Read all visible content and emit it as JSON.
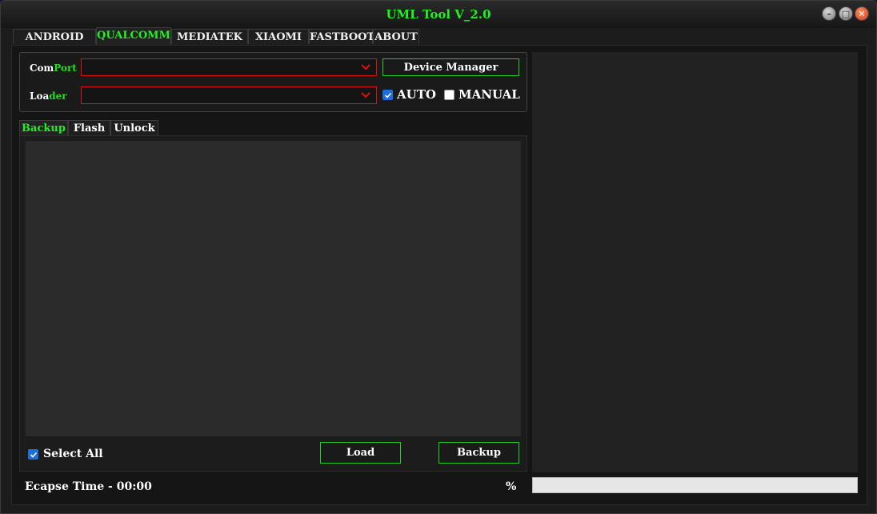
{
  "window": {
    "title": "UML Tool V_2.0",
    "controls": [
      "minimize",
      "maximize",
      "close"
    ]
  },
  "main_tabs": [
    {
      "label": "ANDROID",
      "active": false
    },
    {
      "label": "QUALCOMM",
      "active": true
    },
    {
      "label": "MEDIATEK",
      "active": false
    },
    {
      "label": "XIAOMI",
      "active": false
    },
    {
      "label": "FASTBOOT",
      "active": false
    },
    {
      "label": "ABOUT",
      "active": false
    }
  ],
  "connection": {
    "comport_label_a": "Com",
    "comport_label_b": "Port",
    "comport_value": "",
    "loader_label_a": "Loa",
    "loader_label_b": "der",
    "loader_value": "",
    "device_manager_label": "Device Manager",
    "auto_label": "AUTO",
    "auto_checked": true,
    "manual_label": "MANUAL",
    "manual_checked": false
  },
  "sub_tabs": [
    {
      "label": "Backup",
      "active": true
    },
    {
      "label": "Flash",
      "active": false
    },
    {
      "label": "Unlock",
      "active": false
    }
  ],
  "backup": {
    "select_all_label": "Select All",
    "select_all_checked": true,
    "load_label": "Load",
    "backup_label": "Backup"
  },
  "status": {
    "elapsed_text": "Ecapse Time - 00:00",
    "percent_symbol": "%",
    "progress": 0
  },
  "colors": {
    "accent_green": "#22ee22",
    "border_red": "#dd1111",
    "checkbox_blue": "#1e6fd9",
    "background": "#1c1c1c"
  }
}
